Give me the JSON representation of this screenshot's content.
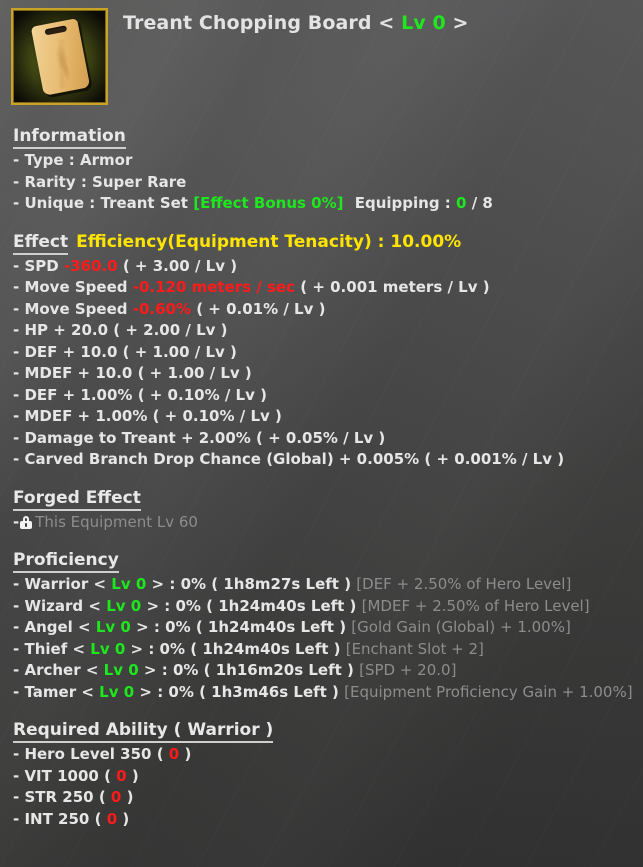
{
  "item": {
    "name": "Treant Chopping Board",
    "level_prefix": "<",
    "level": "Lv 0",
    "level_suffix": ">",
    "icon": "cutting-board-icon"
  },
  "colors": {
    "green": "#1de81d",
    "red": "#ff1a1a",
    "yellow": "#ffe400",
    "dim": "#8d8d8d",
    "text": "#e6e6e6",
    "frame_gold": "#c9a227"
  },
  "information": {
    "heading": "Information",
    "lines": [
      {
        "label": "- Type : Armor"
      },
      {
        "label": "- Rarity : Super Rare"
      }
    ],
    "unique": {
      "label": "- Unique : Treant Set",
      "bonus": "[Effect Bonus 0%]",
      "equipping_label": "Equipping :",
      "equipped": "0",
      "equipped_sep": "/",
      "equipped_total": "8"
    }
  },
  "effect": {
    "heading": "Effect",
    "efficiency": "Efficiency(Equipment Tenacity) : 10.00%",
    "lines": [
      {
        "label": "- SPD",
        "value": "-360.0",
        "value_color": "red",
        "scaling": "( + 3.00 / Lv )"
      },
      {
        "label": "- Move Speed",
        "value": "-0.120 meters / sec",
        "value_color": "red",
        "scaling": "( + 0.001 meters / Lv )"
      },
      {
        "label": "- Move Speed",
        "value": "-0.60%",
        "value_color": "red",
        "scaling": "( + 0.01% / Lv )"
      },
      {
        "label": "- HP + 20.0",
        "value": "",
        "value_color": "none",
        "scaling": "( + 2.00 / Lv )"
      },
      {
        "label": "- DEF + 10.0",
        "value": "",
        "value_color": "none",
        "scaling": "( + 1.00 / Lv )"
      },
      {
        "label": "- MDEF + 10.0",
        "value": "",
        "value_color": "none",
        "scaling": "( + 1.00 / Lv )"
      },
      {
        "label": "- DEF + 1.00%",
        "value": "",
        "value_color": "none",
        "scaling": "( + 0.10% / Lv )"
      },
      {
        "label": "- MDEF + 1.00%",
        "value": "",
        "value_color": "none",
        "scaling": "( + 0.10% / Lv )"
      },
      {
        "label": "- Damage to Treant + 2.00%",
        "value": "",
        "value_color": "none",
        "scaling": "( + 0.05% / Lv )"
      },
      {
        "label": "- Carved Branch Drop Chance (Global) + 0.005%",
        "value": "",
        "value_color": "none",
        "scaling": "( + 0.001% / Lv )"
      }
    ]
  },
  "forged_effect": {
    "heading": "Forged Effect",
    "dash": "-",
    "icon": "lock-icon",
    "locked_text": "This Equipment Lv 60"
  },
  "proficiency": {
    "heading": "Proficiency",
    "rows": [
      {
        "dash": "-",
        "name": "Warrior",
        "lt": "<",
        "level": "Lv 0",
        "gt": ">",
        "percent": ": 0%",
        "time": "( 1h8m27s Left )",
        "bonus": "[DEF + 2.50% of Hero Level]"
      },
      {
        "dash": "-",
        "name": "Wizard",
        "lt": "<",
        "level": "Lv 0",
        "gt": ">",
        "percent": ": 0%",
        "time": "( 1h24m40s Left )",
        "bonus": "[MDEF + 2.50% of Hero Level]"
      },
      {
        "dash": "-",
        "name": "Angel",
        "lt": "<",
        "level": "Lv 0",
        "gt": ">",
        "percent": ": 0%",
        "time": "( 1h24m40s Left )",
        "bonus": "[Gold Gain (Global) + 1.00%]"
      },
      {
        "dash": "-",
        "name": "Thief",
        "lt": "<",
        "level": "Lv 0",
        "gt": ">",
        "percent": ": 0%",
        "time": "( 1h24m40s Left )",
        "bonus": "[Enchant Slot + 2]"
      },
      {
        "dash": "-",
        "name": "Archer",
        "lt": "<",
        "level": "Lv 0",
        "gt": ">",
        "percent": ": 0%",
        "time": "( 1h16m20s Left )",
        "bonus": "[SPD + 20.0]"
      },
      {
        "dash": "-",
        "name": "Tamer",
        "lt": "<",
        "level": "Lv 0",
        "gt": ">",
        "percent": ": 0%",
        "time": "( 1h3m46s Left )",
        "bonus": "[Equipment Proficiency Gain + 1.00%]"
      }
    ]
  },
  "required_ability": {
    "heading": "Required Ability ( Warrior )",
    "rows": [
      {
        "label": "- Hero Level 350",
        "open": "(",
        "current": "0",
        "close": ")"
      },
      {
        "label": "- VIT 1000",
        "open": "(",
        "current": "0",
        "close": ")"
      },
      {
        "label": "- STR 250",
        "open": "(",
        "current": "0",
        "close": ")"
      },
      {
        "label": "- INT 250",
        "open": "(",
        "current": "0",
        "close": ")"
      }
    ]
  }
}
